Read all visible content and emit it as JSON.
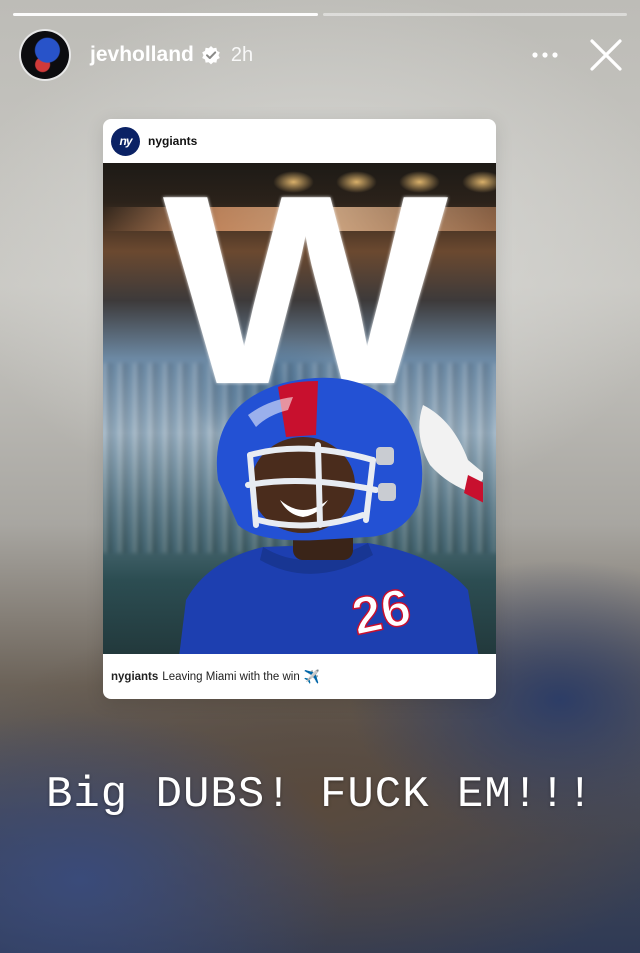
{
  "progress": {
    "segments": 2,
    "completed": 1
  },
  "header": {
    "username": "jevholland",
    "verified": true,
    "time_ago": "2h",
    "avatar_icon": "profile-avatar",
    "more_icon": "more-dots-icon",
    "close_icon": "close-icon"
  },
  "shared_post": {
    "account": "nygiants",
    "logo_text": "ny",
    "logo_color": "#0b2265",
    "image_overlay_text": "W",
    "player_number": "26",
    "caption_user": "nygiants",
    "caption_text": "Leaving Miami with the win",
    "caption_emoji": "✈️"
  },
  "story_text": "Big DUBS! FUCK EM!!!"
}
